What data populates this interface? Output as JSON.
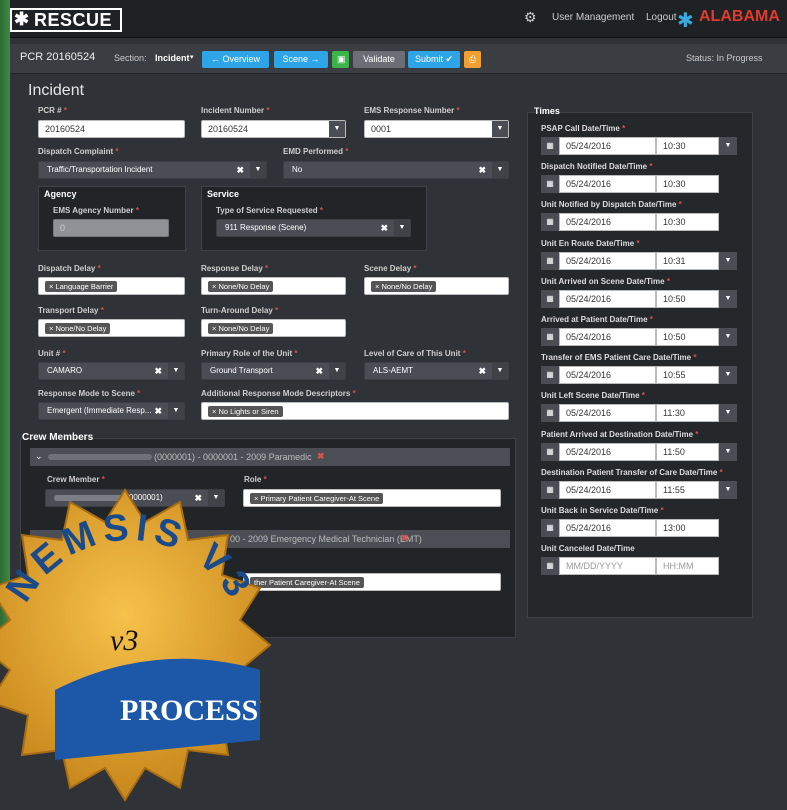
{
  "brand": {
    "logo": "RESCUE",
    "state_logo": "ALABAMA"
  },
  "topnav": {
    "user_management": "User Management",
    "logout": "Logout"
  },
  "subbar": {
    "pcr": "PCR 20160524",
    "section_prefix": "Section:",
    "section": "Incident",
    "overview": "Overview",
    "scene": "Scene",
    "validate": "Validate",
    "submit": "Submit",
    "status": "Status: In Progress"
  },
  "incident": {
    "title": "Incident",
    "pcr_label": "PCR #",
    "pcr_value": "20160524",
    "incident_number_label": "Incident Number",
    "incident_number_value": "20160524",
    "ems_response_label": "EMS Response Number",
    "ems_response_value": "0001",
    "dispatch_complaint_label": "Dispatch Complaint",
    "dispatch_complaint_value": "Traffic/Transportation Incident",
    "emd_label": "EMD Performed",
    "emd_value": "No",
    "agency_title": "Agency",
    "agency_num_label": "EMS Agency Number",
    "agency_num_value": "0",
    "service_title": "Service",
    "service_type_label": "Type of Service Requested",
    "service_type_value": "911 Response (Scene)",
    "dispatch_delay_label": "Dispatch Delay",
    "dispatch_delay_value": "Language Barrier",
    "response_delay_label": "Response Delay",
    "response_delay_value": "None/No Delay",
    "scene_delay_label": "Scene Delay",
    "scene_delay_value": "None/No Delay",
    "transport_delay_label": "Transport Delay",
    "transport_delay_value": "None/No Delay",
    "turnaround_label": "Turn-Around Delay",
    "turnaround_value": "None/No Delay",
    "unit_label": "Unit #",
    "unit_value": "CAMARO",
    "role_label": "Primary Role of the Unit",
    "role_value": "Ground Transport",
    "level_label": "Level of Care of This Unit",
    "level_value": "ALS-AEMT",
    "mode_label": "Response Mode to Scene",
    "mode_value": "Emergent (Immediate Resp...",
    "descriptors_label": "Additional Response Mode Descriptors",
    "descriptors_value": "No Lights or Siren"
  },
  "crew": {
    "title": "Crew Members",
    "member1_header": "(0000001) - 0000001 - 2009 Paramedic",
    "member_label": "Crew Member",
    "member1_value": "(0000001)",
    "role_label": "Role",
    "member1_role": "Primary Patient Caregiver-At Scene",
    "member2_header": "00 - 2009 Emergency Medical Technician (EMT)",
    "member2_role": "ther Patient Caregiver-At Scene"
  },
  "times": {
    "title": "Times",
    "rows": [
      {
        "label": "PSAP Call Date/Time",
        "date": "05/24/2016",
        "time": "10:30",
        "dropdown": true,
        "req": true
      },
      {
        "label": "Dispatch Notified Date/Time",
        "date": "05/24/2016",
        "time": "10:30",
        "dropdown": false,
        "req": true
      },
      {
        "label": "Unit Notified by Dispatch Date/Time",
        "date": "05/24/2016",
        "time": "10:30",
        "dropdown": false,
        "req": true
      },
      {
        "label": "Unit En Route Date/Time",
        "date": "05/24/2016",
        "time": "10:31",
        "dropdown": true,
        "req": true
      },
      {
        "label": "Unit Arrived on Scene Date/Time",
        "date": "05/24/2016",
        "time": "10:50",
        "dropdown": true,
        "req": true
      },
      {
        "label": "Arrived at Patient Date/Time",
        "date": "05/24/2016",
        "time": "10:50",
        "dropdown": true,
        "req": true
      },
      {
        "label": "Transfer of EMS Patient Care Date/Time",
        "date": "05/24/2016",
        "time": "10:55",
        "dropdown": true,
        "req": true
      },
      {
        "label": "Unit Left Scene Date/Time",
        "date": "05/24/2016",
        "time": "11:30",
        "dropdown": true,
        "req": true
      },
      {
        "label": "Patient Arrived at Destination Date/Time",
        "date": "05/24/2016",
        "time": "11:50",
        "dropdown": true,
        "req": true
      },
      {
        "label": "Destination Patient Transfer of Care Date/Time",
        "date": "05/24/2016",
        "time": "11:55",
        "dropdown": true,
        "req": true
      },
      {
        "label": "Unit Back in Service Date/Time",
        "date": "05/24/2016",
        "time": "13:00",
        "dropdown": false,
        "req": true
      },
      {
        "label": "Unit Canceled Date/Time",
        "date": "MM/DD/YYYY",
        "time": "HH:MM",
        "dropdown": false,
        "req": false,
        "placeholder": true
      }
    ]
  },
  "badge": {
    "arc": "NEMSIS V3",
    "version": "v3",
    "ribbon": "PROCESS"
  },
  "colors": {
    "overview": "#2ea5e6",
    "scene": "#2ea5e6",
    "save": "#3bb44a",
    "validate": "#6b6f75",
    "submit": "#2ea5e6",
    "print": "#f0a030",
    "required": "#d9534f"
  }
}
